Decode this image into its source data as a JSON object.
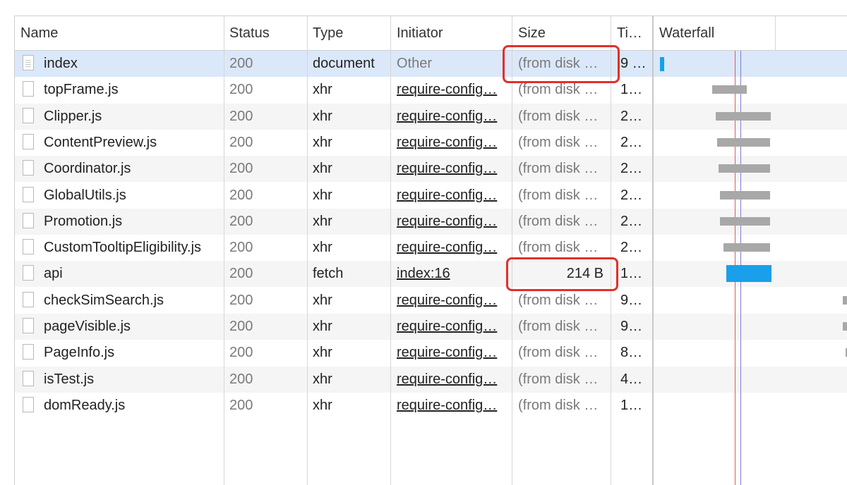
{
  "columns": [
    "Name",
    "Status",
    "Type",
    "Initiator",
    "Size",
    "Ti…",
    "Waterfall"
  ],
  "requests": [
    {
      "name": "index",
      "status": "200",
      "type": "document",
      "initiator": "Other",
      "initiator_is_link": false,
      "size": "(from disk …",
      "time": "9 …",
      "icon": "document-file-icon",
      "selected": true
    },
    {
      "name": "topFrame.js",
      "status": "200",
      "type": "xhr",
      "initiator": "require-config…",
      "initiator_is_link": true,
      "size": "(from disk …",
      "time": "1…",
      "icon": "file-icon"
    },
    {
      "name": "Clipper.js",
      "status": "200",
      "type": "xhr",
      "initiator": "require-config…",
      "initiator_is_link": true,
      "size": "(from disk …",
      "time": "2…",
      "icon": "file-icon"
    },
    {
      "name": "ContentPreview.js",
      "status": "200",
      "type": "xhr",
      "initiator": "require-config…",
      "initiator_is_link": true,
      "size": "(from disk …",
      "time": "2…",
      "icon": "file-icon"
    },
    {
      "name": "Coordinator.js",
      "status": "200",
      "type": "xhr",
      "initiator": "require-config…",
      "initiator_is_link": true,
      "size": "(from disk …",
      "time": "2…",
      "icon": "file-icon"
    },
    {
      "name": "GlobalUtils.js",
      "status": "200",
      "type": "xhr",
      "initiator": "require-config…",
      "initiator_is_link": true,
      "size": "(from disk …",
      "time": "2…",
      "icon": "file-icon"
    },
    {
      "name": "Promotion.js",
      "status": "200",
      "type": "xhr",
      "initiator": "require-config…",
      "initiator_is_link": true,
      "size": "(from disk …",
      "time": "2…",
      "icon": "file-icon"
    },
    {
      "name": "CustomTooltipEligibility.js",
      "status": "200",
      "type": "xhr",
      "initiator": "require-config…",
      "initiator_is_link": true,
      "size": "(from disk …",
      "time": "2…",
      "icon": "file-icon"
    },
    {
      "name": "api",
      "status": "200",
      "type": "fetch",
      "initiator": "index:16",
      "initiator_is_link": true,
      "size": "214 B",
      "time": "1…",
      "icon": "file-icon"
    },
    {
      "name": "checkSimSearch.js",
      "status": "200",
      "type": "xhr",
      "initiator": "require-config…",
      "initiator_is_link": true,
      "size": "(from disk …",
      "time": "9…",
      "icon": "file-icon"
    },
    {
      "name": "pageVisible.js",
      "status": "200",
      "type": "xhr",
      "initiator": "require-config…",
      "initiator_is_link": true,
      "size": "(from disk …",
      "time": "9…",
      "icon": "file-icon"
    },
    {
      "name": "PageInfo.js",
      "status": "200",
      "type": "xhr",
      "initiator": "require-config…",
      "initiator_is_link": true,
      "size": "(from disk …",
      "time": "8…",
      "icon": "file-icon"
    },
    {
      "name": "isTest.js",
      "status": "200",
      "type": "xhr",
      "initiator": "require-config…",
      "initiator_is_link": true,
      "size": "(from disk …",
      "time": "4…",
      "icon": "file-icon"
    },
    {
      "name": "domReady.js",
      "status": "200",
      "type": "xhr",
      "initiator": "require-config…",
      "initiator_is_link": true,
      "size": "(from disk …",
      "time": "1…",
      "icon": "file-icon"
    }
  ],
  "colors": {
    "selected_row": "#dbe8f9",
    "waterfall_bar": "#a8a8a8",
    "waterfall_bar_active": "#1a9fea",
    "highlight_box": "#e0302b",
    "load_marker": "#e05a5a",
    "domcontentloaded_marker": "#7b7bdc"
  }
}
